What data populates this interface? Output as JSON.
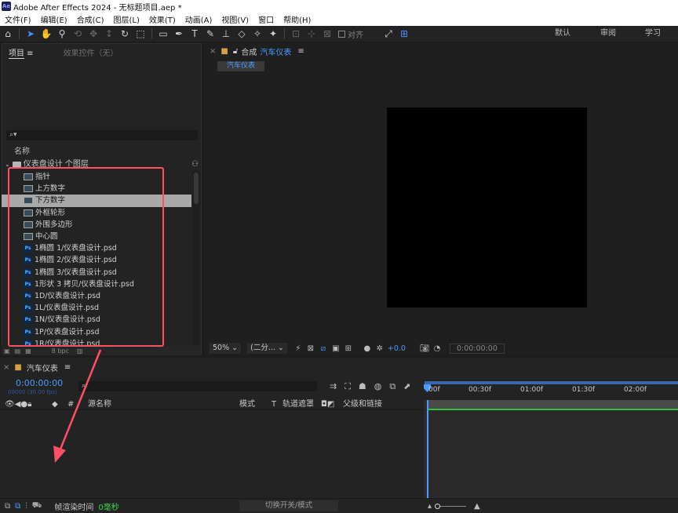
{
  "window": {
    "title": "Adobe After Effects 2024 - 无标题项目.aep *",
    "logo": "Ae"
  },
  "menu": [
    "文件(F)",
    "编辑(E)",
    "合成(C)",
    "图层(L)",
    "效果(T)",
    "动画(A)",
    "视图(V)",
    "窗口",
    "帮助(H)"
  ],
  "toolbar": {
    "snap_label": "对齐",
    "workspaces": [
      "默认",
      "审阅",
      "学习"
    ]
  },
  "project": {
    "tab_project": "项目",
    "tab_effects": "效果控件（无）",
    "search_icon": "⌕▾",
    "col_name": "名称",
    "folder": "仪表盘设计 个图层",
    "items": [
      {
        "type": "comp",
        "label": "指针"
      },
      {
        "type": "comp",
        "label": "上方数字"
      },
      {
        "type": "comp",
        "label": "下方数字",
        "selected": true
      },
      {
        "type": "comp",
        "label": "外框轮形"
      },
      {
        "type": "comp",
        "label": "外围多边形"
      },
      {
        "type": "comp",
        "label": "中心圆"
      },
      {
        "type": "psd",
        "label": "1椭圆 1/仪表盘设计.psd"
      },
      {
        "type": "psd",
        "label": "1椭圆 2/仪表盘设计.psd"
      },
      {
        "type": "psd",
        "label": "1椭圆 3/仪表盘设计.psd"
      },
      {
        "type": "psd",
        "label": "1形状 3 拷贝/仪表盘设计.psd"
      },
      {
        "type": "psd",
        "label": "1D/仪表盘设计.psd"
      },
      {
        "type": "psd",
        "label": "1L/仪表盘设计.psd"
      },
      {
        "type": "psd",
        "label": "1N/仪表盘设计.psd"
      },
      {
        "type": "psd",
        "label": "1P/仪表盘设计.psd"
      },
      {
        "type": "psd",
        "label": "1R/仪表盘设计.psd"
      }
    ],
    "footer_bpc": "8 bpc"
  },
  "composition": {
    "tab_prefix": "合成",
    "tab_name": "汽车仪表",
    "breadcrumb": "汽车仪表",
    "zoom": "50%",
    "resolution": "(二分...",
    "exposure": "+0.0",
    "timecode": "0:00:00:00"
  },
  "timeline": {
    "tab": "汽车仪表",
    "timecode": "0:00:00:00",
    "frames_fps": "00000 (30.00 fps)",
    "columns": {
      "source_name": "源名称",
      "mode": "模式",
      "t": "T",
      "track_matte": "轨道遮罩",
      "parent": "父级和链接"
    },
    "ruler": [
      "00f",
      "00:30f",
      "01:00f",
      "01:30f",
      "02:00f"
    ]
  },
  "status": {
    "render_time_label": "帧渲染时间",
    "render_time_value": "0毫秒",
    "toggle_label": "切换开关/模式"
  },
  "colors": {
    "accent": "#4a9bff",
    "highlight": "#ff4f63",
    "green": "#2fc23a"
  }
}
